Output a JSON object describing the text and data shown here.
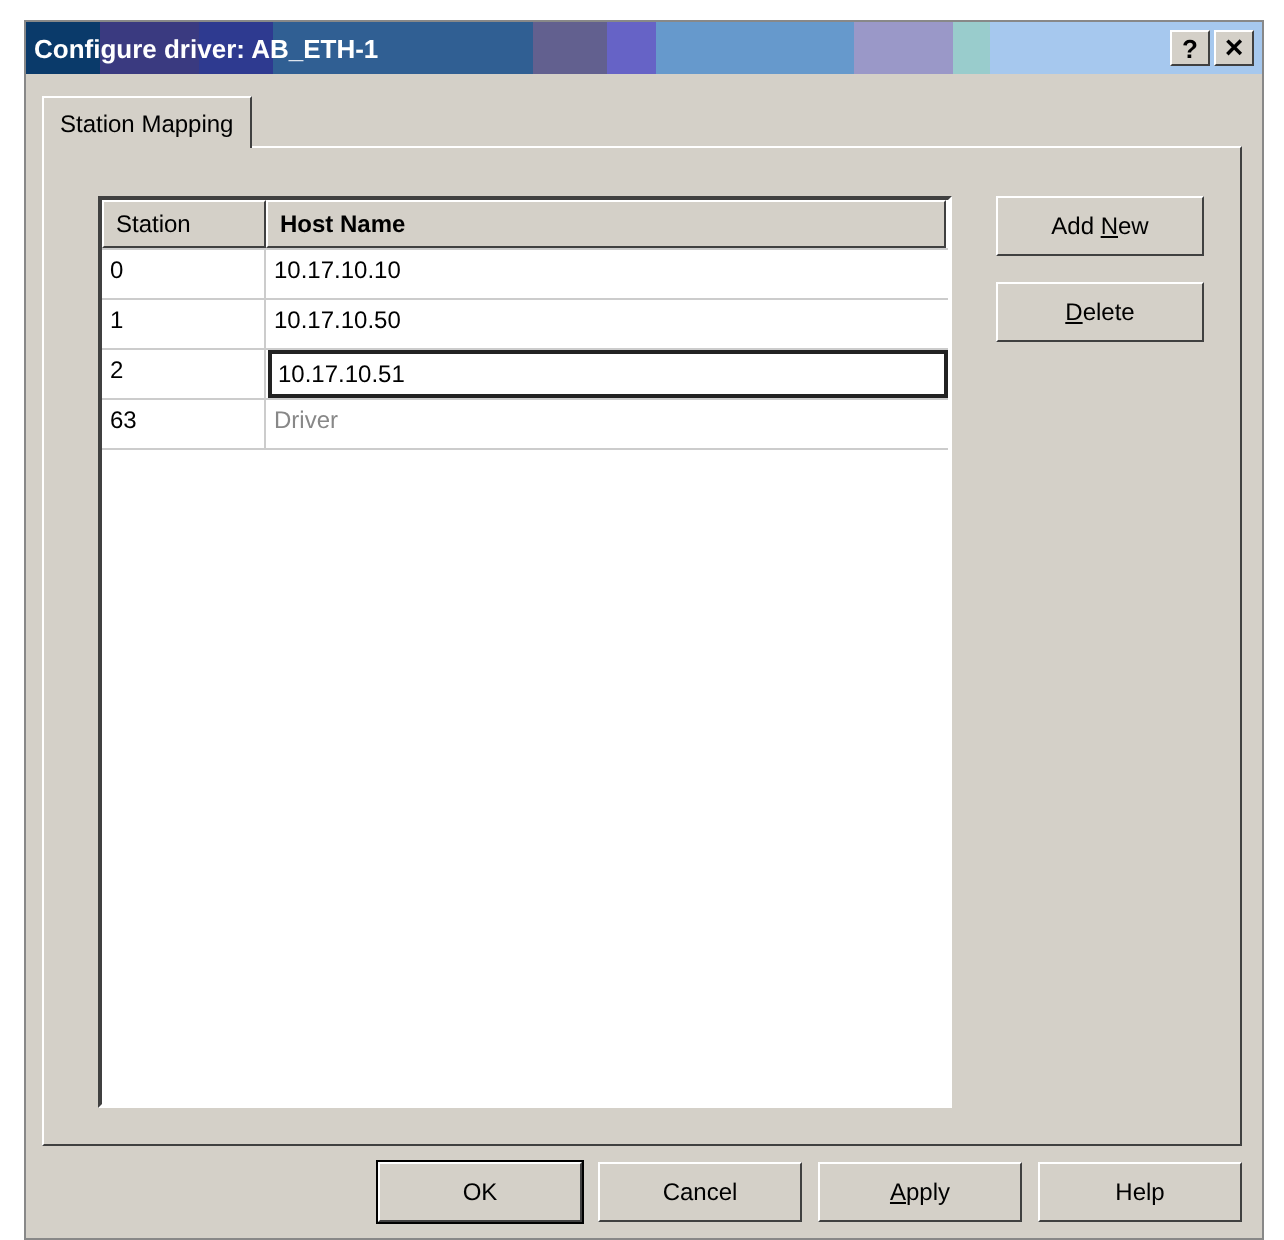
{
  "window": {
    "title": "Configure driver: AB_ETH-1",
    "title_buttons": [
      {
        "kind": "help",
        "label": "?"
      },
      {
        "kind": "close",
        "label": "×"
      }
    ]
  },
  "tabs": [
    {
      "label": "Station Mapping",
      "selected": true
    }
  ],
  "table": {
    "columns": [
      {
        "label": "Station",
        "bold": false
      },
      {
        "label": "Host Name",
        "bold": true
      }
    ],
    "rows": [
      {
        "station": "0",
        "host": "10.17.10.10",
        "editing": false,
        "disabled": false
      },
      {
        "station": "1",
        "host": "10.17.10.50",
        "editing": false,
        "disabled": false
      },
      {
        "station": "2",
        "host": "10.17.10.51",
        "editing": true,
        "disabled": false
      },
      {
        "station": "63",
        "host": "Driver",
        "editing": false,
        "disabled": true
      }
    ]
  },
  "side_buttons": [
    {
      "parts": [
        {
          "text": "Add ",
          "underline": false
        },
        {
          "text": "N",
          "underline": true
        },
        {
          "text": "ew",
          "underline": false
        }
      ]
    },
    {
      "parts": [
        {
          "text": "D",
          "underline": true
        },
        {
          "text": "elete",
          "underline": false
        }
      ]
    }
  ],
  "buttons": [
    {
      "parts": [
        {
          "text": "OK",
          "underline": false
        }
      ],
      "default": true
    },
    {
      "parts": [
        {
          "text": "Cancel",
          "underline": false
        }
      ],
      "default": false
    },
    {
      "parts": [
        {
          "text": "A",
          "underline": true
        },
        {
          "text": "pply",
          "underline": false
        }
      ],
      "default": false
    },
    {
      "parts": [
        {
          "text": "Help",
          "underline": false
        }
      ],
      "default": false
    }
  ]
}
